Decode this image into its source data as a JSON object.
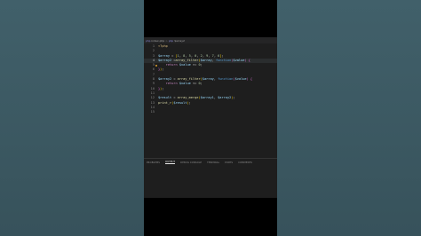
{
  "tab": {
    "icon": "php",
    "file_name": "index.php",
    "separator": ">",
    "symbol_icon": "php",
    "symbol": "$array2"
  },
  "code_lines": [
    {
      "num": "1",
      "tokens": [
        {
          "t": "<?php",
          "c": "t-tag"
        }
      ]
    },
    {
      "num": "2",
      "tokens": []
    },
    {
      "num": "3",
      "tokens": [
        {
          "t": "$array",
          "c": "t-var"
        },
        {
          "t": " = ",
          "c": "t-op"
        },
        {
          "t": "[",
          "c": "t-br1"
        },
        {
          "t": "1",
          "c": "t-num"
        },
        {
          "t": ", ",
          "c": "t-op"
        },
        {
          "t": "8",
          "c": "t-num"
        },
        {
          "t": ", ",
          "c": "t-op"
        },
        {
          "t": "5",
          "c": "t-num"
        },
        {
          "t": ", ",
          "c": "t-op"
        },
        {
          "t": "0",
          "c": "t-num"
        },
        {
          "t": ", ",
          "c": "t-op"
        },
        {
          "t": "2",
          "c": "t-num"
        },
        {
          "t": ", ",
          "c": "t-op"
        },
        {
          "t": "9",
          "c": "t-num"
        },
        {
          "t": ", ",
          "c": "t-op"
        },
        {
          "t": "7",
          "c": "t-num"
        },
        {
          "t": ", ",
          "c": "t-op"
        },
        {
          "t": "6",
          "c": "t-num"
        },
        {
          "t": "]",
          "c": "t-br1"
        },
        {
          "t": ";",
          "c": "t-op"
        }
      ]
    },
    {
      "num": "4",
      "active": true,
      "tokens": [
        {
          "t": "$array2",
          "c": "t-var"
        },
        {
          "t": " =",
          "c": "t-op"
        },
        {
          "t": "array_filter",
          "c": "t-fn"
        },
        {
          "t": "(",
          "c": "t-br1"
        },
        {
          "t": "$array",
          "c": "t-var"
        },
        {
          "t": ", ",
          "c": "t-op"
        },
        {
          "t": "function",
          "c": "t-kw2"
        },
        {
          "t": "(",
          "c": "t-br2"
        },
        {
          "t": "$value",
          "c": "t-var"
        },
        {
          "t": ")",
          "c": "t-br2"
        },
        {
          "t": " {",
          "c": "t-br2"
        }
      ]
    },
    {
      "num": "5",
      "dot": true,
      "tokens": [
        {
          "t": "    ",
          "c": "t-op"
        },
        {
          "t": "return",
          "c": "t-kw"
        },
        {
          "t": " ",
          "c": "t-op"
        },
        {
          "t": "$value",
          "c": "t-var"
        },
        {
          "t": " >= ",
          "c": "t-op"
        },
        {
          "t": "0",
          "c": "t-num"
        },
        {
          "t": ";",
          "c": "t-op"
        }
      ]
    },
    {
      "num": "6",
      "tokens": [
        {
          "t": "}",
          "c": "t-br2"
        },
        {
          "t": ")",
          "c": "t-br1"
        },
        {
          "t": ";",
          "c": "t-op"
        }
      ]
    },
    {
      "num": "7",
      "tokens": []
    },
    {
      "num": "8",
      "tokens": [
        {
          "t": "$array2",
          "c": "t-var"
        },
        {
          "t": " = ",
          "c": "t-op"
        },
        {
          "t": "array_filter",
          "c": "t-fn"
        },
        {
          "t": "(",
          "c": "t-br1"
        },
        {
          "t": "$array",
          "c": "t-var"
        },
        {
          "t": ", ",
          "c": "t-op"
        },
        {
          "t": "function",
          "c": "t-kw2"
        },
        {
          "t": "(",
          "c": "t-br2"
        },
        {
          "t": "$value",
          "c": "t-var"
        },
        {
          "t": ")",
          "c": "t-br2"
        },
        {
          "t": " {",
          "c": "t-br2"
        }
      ]
    },
    {
      "num": "9",
      "tokens": [
        {
          "t": "    ",
          "c": "t-op"
        },
        {
          "t": "return",
          "c": "t-kw"
        },
        {
          "t": " ",
          "c": "t-op"
        },
        {
          "t": "$value",
          "c": "t-var"
        },
        {
          "t": " <= ",
          "c": "t-op"
        },
        {
          "t": "0",
          "c": "t-num"
        },
        {
          "t": ";",
          "c": "t-op"
        }
      ]
    },
    {
      "num": "10",
      "tokens": [
        {
          "t": "}",
          "c": "t-br2"
        },
        {
          "t": ")",
          "c": "t-br1"
        },
        {
          "t": ";",
          "c": "t-op"
        }
      ]
    },
    {
      "num": "11",
      "tokens": []
    },
    {
      "num": "12",
      "tokens": [
        {
          "t": "$result",
          "c": "t-var"
        },
        {
          "t": " = ",
          "c": "t-op"
        },
        {
          "t": "array_merge",
          "c": "t-fn"
        },
        {
          "t": "(",
          "c": "t-br1"
        },
        {
          "t": "$array1",
          "c": "t-var"
        },
        {
          "t": ", ",
          "c": "t-op"
        },
        {
          "t": "$array2",
          "c": "t-var"
        },
        {
          "t": ")",
          "c": "t-br1"
        },
        {
          "t": ";",
          "c": "t-op"
        }
      ]
    },
    {
      "num": "13",
      "tokens": [
        {
          "t": "print_r",
          "c": "t-fn"
        },
        {
          "t": "(",
          "c": "t-br1"
        },
        {
          "t": "$result",
          "c": "t-var"
        },
        {
          "t": ")",
          "c": "t-br1"
        },
        {
          "t": ";",
          "c": "t-op"
        }
      ]
    },
    {
      "num": "14",
      "tokens": []
    },
    {
      "num": "15",
      "tokens": []
    }
  ],
  "panel": {
    "tabs": [
      {
        "label": "PROBLEMS",
        "active": false
      },
      {
        "label": "OUTPUT",
        "active": true
      },
      {
        "label": "DEBUG CONSOLE",
        "active": false
      },
      {
        "label": "TERMINAL",
        "active": false
      },
      {
        "label": "PORTS",
        "active": false
      },
      {
        "label": "COMMENTS",
        "active": false
      }
    ]
  }
}
